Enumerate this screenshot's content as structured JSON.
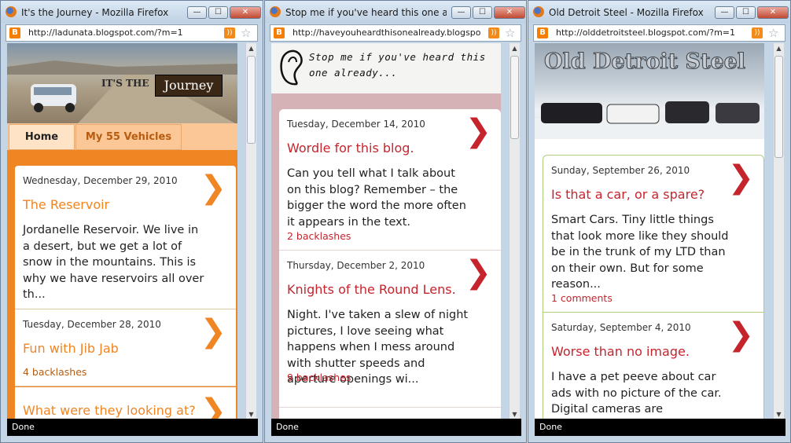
{
  "windows": [
    {
      "title": "It's the Journey - Mozilla Firefox",
      "url": "http://ladunata.blogspot.com/?m=1",
      "header_text": "Journey",
      "header_prefix": "IT'S THE",
      "tabs": [
        "Home",
        "My 55 Vehicles"
      ],
      "accent": "#f08524",
      "posts": [
        {
          "date": "Wednesday, December 29, 2010",
          "title": "The Reservoir",
          "body": "Jordanelle Reservoir.  We live in a desert, but we get a lot of snow in the mountains.  This is why we have reservoirs all over th...",
          "comments": ""
        },
        {
          "date": "Tuesday, December 28, 2010",
          "title": "Fun with Jib Jab",
          "body": "",
          "comments": "4 backlashes"
        },
        {
          "date": "",
          "title": "What were they looking at?",
          "body": "",
          "comments": ""
        }
      ],
      "status": "Done"
    },
    {
      "title": "Stop me if you've heard this one alre...",
      "url": "http://haveyouheardthisonealready.blogspo",
      "header_text": "Stop me if you've heard this one already...",
      "accent": "#c6242d",
      "posts": [
        {
          "date": "Tuesday, December 14, 2010",
          "title": "Wordle for this blog.",
          "body": "Can you tell what I talk about on this blog?  Remember – the bigger the word the more often it appears in the text.",
          "comments": "2 backlashes"
        },
        {
          "date": "Thursday, December 2, 2010",
          "title": "Knights of the Round Lens.",
          "body": "Night.  I've taken a slew of night pictures, I love seeing what happens when I mess around with shutter speeds and aperture openings wi...",
          "comments": "9 backlashes"
        }
      ],
      "status": "Done"
    },
    {
      "title": "Old Detroit Steel - Mozilla Firefox",
      "url": "http://olddetroitsteel.blogspot.com/?m=1",
      "header_text": "Old Detroit Steel",
      "accent": "#c6242d",
      "posts": [
        {
          "date": "Sunday, September 26, 2010",
          "title": "Is that a car, or a spare?",
          "body": "Smart Cars.  Tiny little things that look more like they should be in the trunk of my LTD than on their own.  But for some reason...",
          "comments": "1 comments"
        },
        {
          "date": "Saturday, September 4, 2010",
          "title": "Worse than no image.",
          "body": "I have a pet peeve about car ads with no picture of the car. Digital cameras are",
          "comments": ""
        }
      ],
      "status": "Done"
    }
  ],
  "icons": {
    "chevron": "❯",
    "rss": "rss-icon",
    "star": "bookmark-star-icon",
    "favicon": "blogger-icon"
  },
  "window_buttons": {
    "minimize": "—",
    "maximize": "☐",
    "close": "✕"
  }
}
